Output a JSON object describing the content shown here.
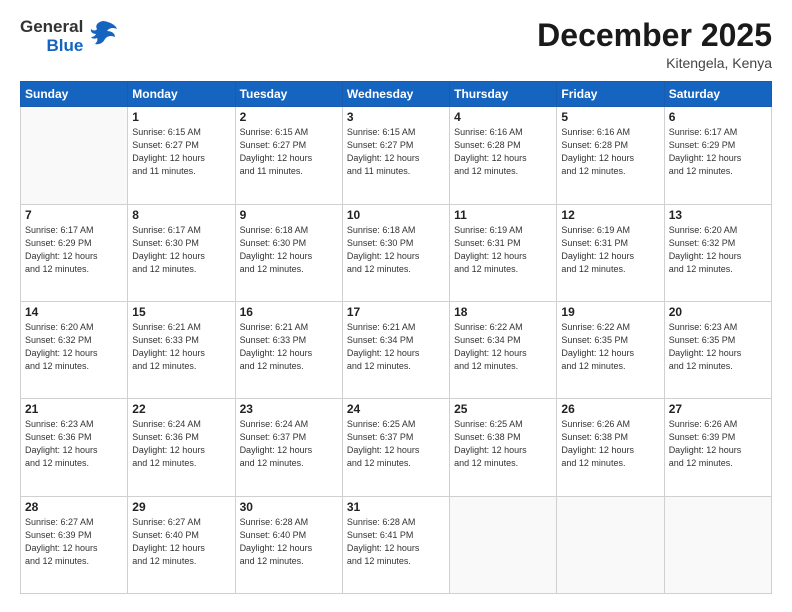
{
  "header": {
    "logo_general": "General",
    "logo_blue": "Blue",
    "month_title": "December 2025",
    "location": "Kitengela, Kenya"
  },
  "days_of_week": [
    "Sunday",
    "Monday",
    "Tuesday",
    "Wednesday",
    "Thursday",
    "Friday",
    "Saturday"
  ],
  "weeks": [
    [
      {
        "day": "",
        "info": ""
      },
      {
        "day": "1",
        "info": "Sunrise: 6:15 AM\nSunset: 6:27 PM\nDaylight: 12 hours\nand 11 minutes."
      },
      {
        "day": "2",
        "info": "Sunrise: 6:15 AM\nSunset: 6:27 PM\nDaylight: 12 hours\nand 11 minutes."
      },
      {
        "day": "3",
        "info": "Sunrise: 6:15 AM\nSunset: 6:27 PM\nDaylight: 12 hours\nand 11 minutes."
      },
      {
        "day": "4",
        "info": "Sunrise: 6:16 AM\nSunset: 6:28 PM\nDaylight: 12 hours\nand 12 minutes."
      },
      {
        "day": "5",
        "info": "Sunrise: 6:16 AM\nSunset: 6:28 PM\nDaylight: 12 hours\nand 12 minutes."
      },
      {
        "day": "6",
        "info": "Sunrise: 6:17 AM\nSunset: 6:29 PM\nDaylight: 12 hours\nand 12 minutes."
      }
    ],
    [
      {
        "day": "7",
        "info": "Sunrise: 6:17 AM\nSunset: 6:29 PM\nDaylight: 12 hours\nand 12 minutes."
      },
      {
        "day": "8",
        "info": "Sunrise: 6:17 AM\nSunset: 6:30 PM\nDaylight: 12 hours\nand 12 minutes."
      },
      {
        "day": "9",
        "info": "Sunrise: 6:18 AM\nSunset: 6:30 PM\nDaylight: 12 hours\nand 12 minutes."
      },
      {
        "day": "10",
        "info": "Sunrise: 6:18 AM\nSunset: 6:30 PM\nDaylight: 12 hours\nand 12 minutes."
      },
      {
        "day": "11",
        "info": "Sunrise: 6:19 AM\nSunset: 6:31 PM\nDaylight: 12 hours\nand 12 minutes."
      },
      {
        "day": "12",
        "info": "Sunrise: 6:19 AM\nSunset: 6:31 PM\nDaylight: 12 hours\nand 12 minutes."
      },
      {
        "day": "13",
        "info": "Sunrise: 6:20 AM\nSunset: 6:32 PM\nDaylight: 12 hours\nand 12 minutes."
      }
    ],
    [
      {
        "day": "14",
        "info": "Sunrise: 6:20 AM\nSunset: 6:32 PM\nDaylight: 12 hours\nand 12 minutes."
      },
      {
        "day": "15",
        "info": "Sunrise: 6:21 AM\nSunset: 6:33 PM\nDaylight: 12 hours\nand 12 minutes."
      },
      {
        "day": "16",
        "info": "Sunrise: 6:21 AM\nSunset: 6:33 PM\nDaylight: 12 hours\nand 12 minutes."
      },
      {
        "day": "17",
        "info": "Sunrise: 6:21 AM\nSunset: 6:34 PM\nDaylight: 12 hours\nand 12 minutes."
      },
      {
        "day": "18",
        "info": "Sunrise: 6:22 AM\nSunset: 6:34 PM\nDaylight: 12 hours\nand 12 minutes."
      },
      {
        "day": "19",
        "info": "Sunrise: 6:22 AM\nSunset: 6:35 PM\nDaylight: 12 hours\nand 12 minutes."
      },
      {
        "day": "20",
        "info": "Sunrise: 6:23 AM\nSunset: 6:35 PM\nDaylight: 12 hours\nand 12 minutes."
      }
    ],
    [
      {
        "day": "21",
        "info": "Sunrise: 6:23 AM\nSunset: 6:36 PM\nDaylight: 12 hours\nand 12 minutes."
      },
      {
        "day": "22",
        "info": "Sunrise: 6:24 AM\nSunset: 6:36 PM\nDaylight: 12 hours\nand 12 minutes."
      },
      {
        "day": "23",
        "info": "Sunrise: 6:24 AM\nSunset: 6:37 PM\nDaylight: 12 hours\nand 12 minutes."
      },
      {
        "day": "24",
        "info": "Sunrise: 6:25 AM\nSunset: 6:37 PM\nDaylight: 12 hours\nand 12 minutes."
      },
      {
        "day": "25",
        "info": "Sunrise: 6:25 AM\nSunset: 6:38 PM\nDaylight: 12 hours\nand 12 minutes."
      },
      {
        "day": "26",
        "info": "Sunrise: 6:26 AM\nSunset: 6:38 PM\nDaylight: 12 hours\nand 12 minutes."
      },
      {
        "day": "27",
        "info": "Sunrise: 6:26 AM\nSunset: 6:39 PM\nDaylight: 12 hours\nand 12 minutes."
      }
    ],
    [
      {
        "day": "28",
        "info": "Sunrise: 6:27 AM\nSunset: 6:39 PM\nDaylight: 12 hours\nand 12 minutes."
      },
      {
        "day": "29",
        "info": "Sunrise: 6:27 AM\nSunset: 6:40 PM\nDaylight: 12 hours\nand 12 minutes."
      },
      {
        "day": "30",
        "info": "Sunrise: 6:28 AM\nSunset: 6:40 PM\nDaylight: 12 hours\nand 12 minutes."
      },
      {
        "day": "31",
        "info": "Sunrise: 6:28 AM\nSunset: 6:41 PM\nDaylight: 12 hours\nand 12 minutes."
      },
      {
        "day": "",
        "info": ""
      },
      {
        "day": "",
        "info": ""
      },
      {
        "day": "",
        "info": ""
      }
    ]
  ]
}
